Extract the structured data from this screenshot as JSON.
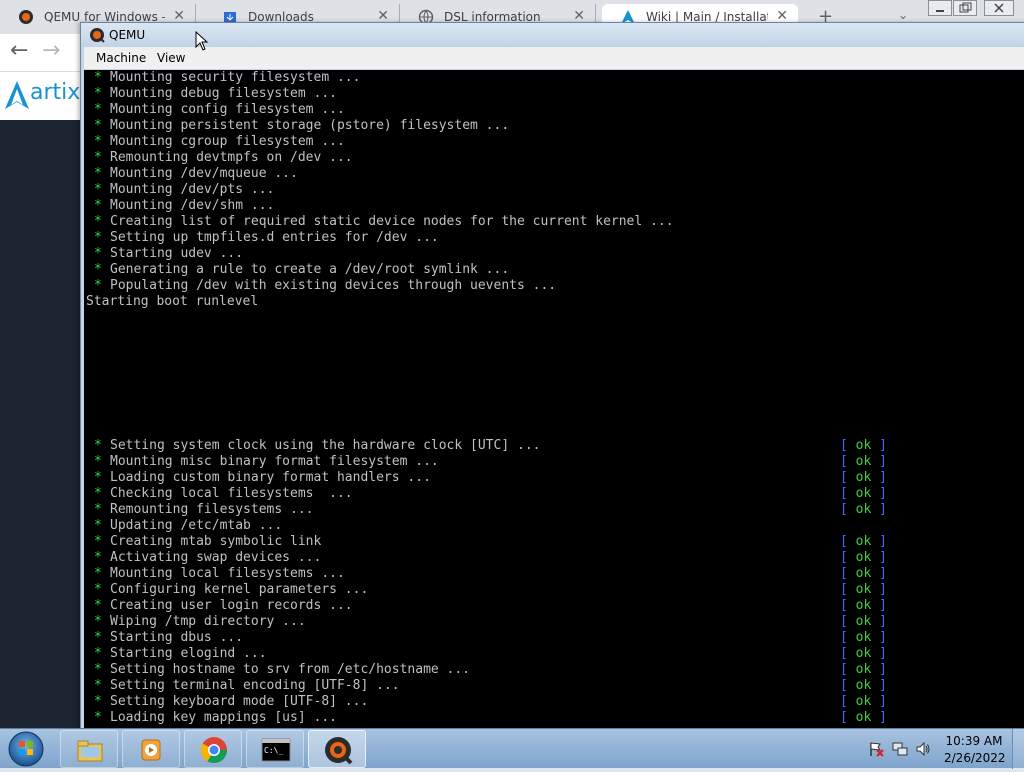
{
  "browser": {
    "tabs": [
      {
        "title": "QEMU for Windows – In",
        "icon": "qemu-icon",
        "active": false
      },
      {
        "title": "Downloads",
        "icon": "download-icon",
        "active": false
      },
      {
        "title": "DSL information",
        "icon": "globe-icon",
        "active": false
      },
      {
        "title": "Wiki | Main / Installation",
        "icon": "artix-icon",
        "active": true
      }
    ],
    "new_tab_label": "+",
    "tab_search_label": "⌄",
    "back_icon": "←",
    "forward_icon": "→",
    "site_logo_text": "artix",
    "colors": {
      "artix_blue": "#1793d1"
    }
  },
  "qemu": {
    "title": "QEMU",
    "menu": {
      "machine": "Machine",
      "view": "View"
    }
  },
  "console": {
    "ok_label": "ok",
    "colors": {
      "star": "#3bd43b",
      "bracket": "#3d6bff",
      "text": "#c0c0c0",
      "background": "#000000"
    },
    "lines": [
      {
        "star": true,
        "text": "Mounting security filesystem ...",
        "ok": false
      },
      {
        "star": true,
        "text": "Mounting debug filesystem ...",
        "ok": false
      },
      {
        "star": true,
        "text": "Mounting config filesystem ...",
        "ok": false
      },
      {
        "star": true,
        "text": "Mounting persistent storage (pstore) filesystem ...",
        "ok": false
      },
      {
        "star": true,
        "text": "Mounting cgroup filesystem ...",
        "ok": false
      },
      {
        "star": true,
        "text": "Remounting devtmpfs on /dev ...",
        "ok": false
      },
      {
        "star": true,
        "text": "Mounting /dev/mqueue ...",
        "ok": false
      },
      {
        "star": true,
        "text": "Mounting /dev/pts ...",
        "ok": false
      },
      {
        "star": true,
        "text": "Mounting /dev/shm ...",
        "ok": false
      },
      {
        "star": true,
        "text": "Creating list of required static device nodes for the current kernel ...",
        "ok": false
      },
      {
        "star": true,
        "text": "Setting up tmpfiles.d entries for /dev ...",
        "ok": false
      },
      {
        "star": true,
        "text": "Starting udev ...",
        "ok": false
      },
      {
        "star": true,
        "text": "Generating a rule to create a /dev/root symlink ...",
        "ok": false
      },
      {
        "star": true,
        "text": "Populating /dev with existing devices through uevents ...",
        "ok": false
      },
      {
        "star": false,
        "text": "Starting boot runlevel",
        "ok": false
      },
      {
        "blank": true
      },
      {
        "blank": true
      },
      {
        "blank": true
      },
      {
        "blank": true
      },
      {
        "blank": true
      },
      {
        "blank": true
      },
      {
        "blank": true
      },
      {
        "blank": true
      },
      {
        "star": true,
        "text": "Setting system clock using the hardware clock [UTC] ...",
        "ok": true
      },
      {
        "star": true,
        "text": "Mounting misc binary format filesystem ...",
        "ok": true
      },
      {
        "star": true,
        "text": "Loading custom binary format handlers ...",
        "ok": true
      },
      {
        "star": true,
        "text": "Checking local filesystems  ...",
        "ok": true
      },
      {
        "star": true,
        "text": "Remounting filesystems ...",
        "ok": true
      },
      {
        "star": true,
        "text": "Updating /etc/mtab ...",
        "ok": false
      },
      {
        "star": true,
        "text": "Creating mtab symbolic link",
        "ok": true
      },
      {
        "star": true,
        "text": "Activating swap devices ...",
        "ok": true
      },
      {
        "star": true,
        "text": "Mounting local filesystems ...",
        "ok": true
      },
      {
        "star": true,
        "text": "Configuring kernel parameters ...",
        "ok": true
      },
      {
        "star": true,
        "text": "Creating user login records ...",
        "ok": true
      },
      {
        "star": true,
        "text": "Wiping /tmp directory ...",
        "ok": true
      },
      {
        "star": true,
        "text": "Starting dbus ...",
        "ok": true
      },
      {
        "star": true,
        "text": "Starting elogind ...",
        "ok": true
      },
      {
        "star": true,
        "text": "Setting hostname to srv from /etc/hostname ...",
        "ok": true
      },
      {
        "star": true,
        "text": "Setting terminal encoding [UTF-8] ...",
        "ok": true
      },
      {
        "star": true,
        "text": "Setting keyboard mode [UTF-8] ...",
        "ok": true
      },
      {
        "star": true,
        "text": "Loading key mappings [us] ...",
        "ok": true
      }
    ]
  },
  "taskbar": {
    "pinned": [
      {
        "name": "file-explorer",
        "icon": "folder-icon",
        "active": false
      },
      {
        "name": "media-player",
        "icon": "media-player-icon",
        "active": false
      },
      {
        "name": "chrome",
        "icon": "chrome-icon",
        "active": false
      },
      {
        "name": "command-prompt",
        "icon": "cmd-icon",
        "active": false
      },
      {
        "name": "qemu",
        "icon": "qemu-icon",
        "active": true
      }
    ],
    "tray_icons": [
      "action-center-flag-icon",
      "network-icon",
      "volume-icon"
    ],
    "clock": {
      "time": "10:39 AM",
      "date": "2/26/2022"
    }
  }
}
